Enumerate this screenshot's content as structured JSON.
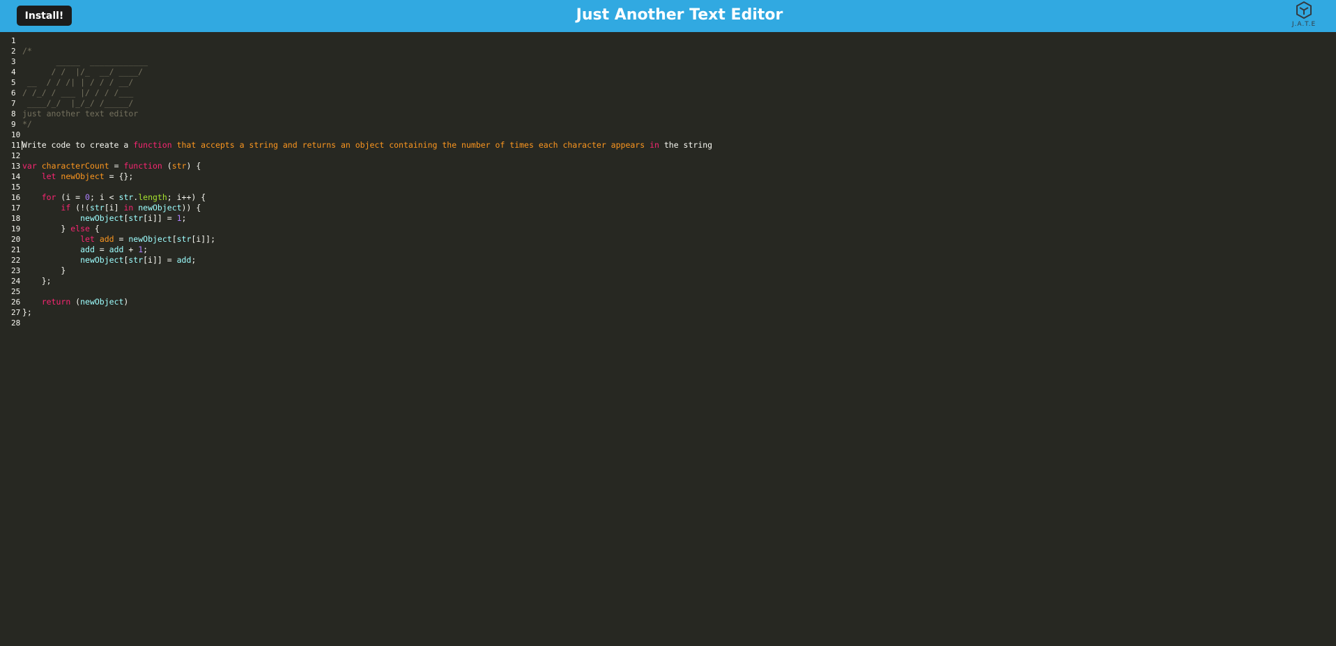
{
  "header": {
    "install_label": "Install!",
    "title": "Just Another Text Editor",
    "logo_text": "J.A.T.E",
    "background": "#31a9e1"
  },
  "editor": {
    "theme_background": "#272822",
    "lines": [
      {
        "n": "1",
        "tokens": []
      },
      {
        "n": "2",
        "tokens": [
          {
            "t": "/*",
            "c": "comment"
          }
        ]
      },
      {
        "n": "3",
        "tokens": [
          {
            "t": "       _____  ____________",
            "c": "comment"
          }
        ]
      },
      {
        "n": "4",
        "tokens": [
          {
            "t": "      / /  |/_  __/ ____/",
            "c": "comment"
          }
        ]
      },
      {
        "n": "5",
        "tokens": [
          {
            "t": " __  / / /| | / / / __/",
            "c": "comment"
          }
        ]
      },
      {
        "n": "6",
        "tokens": [
          {
            "t": "/ /_/ / ___ |/ / / /___",
            "c": "comment"
          }
        ]
      },
      {
        "n": "7",
        "tokens": [
          {
            "t": " ____/_/  |_/_/ /_____/",
            "c": "comment"
          }
        ]
      },
      {
        "n": "8",
        "tokens": [
          {
            "t": "just another text editor",
            "c": "comment"
          }
        ]
      },
      {
        "n": "9",
        "tokens": [
          {
            "t": "*/",
            "c": "comment"
          }
        ]
      },
      {
        "n": "10",
        "tokens": []
      },
      {
        "n": "11",
        "tokens": [
          {
            "t": "Write code to create a ",
            "c": "plain"
          },
          {
            "t": "function",
            "c": "keyword"
          },
          {
            "t": " that accepts a string and returns an object containing the number of times each character appears ",
            "c": "orange"
          },
          {
            "t": "in",
            "c": "keyword"
          },
          {
            "t": " the string",
            "c": "plain"
          }
        ]
      },
      {
        "n": "12",
        "tokens": []
      },
      {
        "n": "13",
        "tokens": [
          {
            "t": "var",
            "c": "keyword"
          },
          {
            "t": " ",
            "c": "plain"
          },
          {
            "t": "characterCount",
            "c": "def"
          },
          {
            "t": " = ",
            "c": "plain"
          },
          {
            "t": "function",
            "c": "keyword"
          },
          {
            "t": " (",
            "c": "plain"
          },
          {
            "t": "str",
            "c": "param"
          },
          {
            "t": ") {",
            "c": "plain"
          }
        ]
      },
      {
        "n": "14",
        "tokens": [
          {
            "t": "    ",
            "c": "plain"
          },
          {
            "t": "let",
            "c": "keyword"
          },
          {
            "t": " ",
            "c": "plain"
          },
          {
            "t": "newObject",
            "c": "def"
          },
          {
            "t": " = {};",
            "c": "plain"
          }
        ]
      },
      {
        "n": "15",
        "tokens": []
      },
      {
        "n": "16",
        "tokens": [
          {
            "t": "    ",
            "c": "plain"
          },
          {
            "t": "for",
            "c": "keyword"
          },
          {
            "t": " (i = ",
            "c": "plain"
          },
          {
            "t": "0",
            "c": "num"
          },
          {
            "t": "; i < ",
            "c": "plain"
          },
          {
            "t": "str",
            "c": "var2"
          },
          {
            "t": ".",
            "c": "plain"
          },
          {
            "t": "length",
            "c": "prop"
          },
          {
            "t": "; i++) {",
            "c": "plain"
          }
        ]
      },
      {
        "n": "17",
        "tokens": [
          {
            "t": "        ",
            "c": "plain"
          },
          {
            "t": "if",
            "c": "keyword"
          },
          {
            "t": " (!(",
            "c": "plain"
          },
          {
            "t": "str",
            "c": "var2"
          },
          {
            "t": "[i] ",
            "c": "plain"
          },
          {
            "t": "in",
            "c": "keyword"
          },
          {
            "t": " ",
            "c": "plain"
          },
          {
            "t": "newObject",
            "c": "var2"
          },
          {
            "t": ")) {",
            "c": "plain"
          }
        ]
      },
      {
        "n": "18",
        "tokens": [
          {
            "t": "            ",
            "c": "plain"
          },
          {
            "t": "newObject",
            "c": "var2"
          },
          {
            "t": "[",
            "c": "plain"
          },
          {
            "t": "str",
            "c": "var2"
          },
          {
            "t": "[i]] = ",
            "c": "plain"
          },
          {
            "t": "1",
            "c": "num"
          },
          {
            "t": ";",
            "c": "plain"
          }
        ]
      },
      {
        "n": "19",
        "tokens": [
          {
            "t": "        } ",
            "c": "plain"
          },
          {
            "t": "else",
            "c": "keyword"
          },
          {
            "t": " {",
            "c": "plain"
          }
        ]
      },
      {
        "n": "20",
        "tokens": [
          {
            "t": "            ",
            "c": "plain"
          },
          {
            "t": "let",
            "c": "keyword"
          },
          {
            "t": " ",
            "c": "plain"
          },
          {
            "t": "add",
            "c": "def"
          },
          {
            "t": " = ",
            "c": "plain"
          },
          {
            "t": "newObject",
            "c": "var2"
          },
          {
            "t": "[",
            "c": "plain"
          },
          {
            "t": "str",
            "c": "var2"
          },
          {
            "t": "[i]];",
            "c": "plain"
          }
        ]
      },
      {
        "n": "21",
        "tokens": [
          {
            "t": "            ",
            "c": "plain"
          },
          {
            "t": "add",
            "c": "var2"
          },
          {
            "t": " = ",
            "c": "plain"
          },
          {
            "t": "add",
            "c": "var2"
          },
          {
            "t": " + ",
            "c": "plain"
          },
          {
            "t": "1",
            "c": "num"
          },
          {
            "t": ";",
            "c": "plain"
          }
        ]
      },
      {
        "n": "22",
        "tokens": [
          {
            "t": "            ",
            "c": "plain"
          },
          {
            "t": "newObject",
            "c": "var2"
          },
          {
            "t": "[",
            "c": "plain"
          },
          {
            "t": "str",
            "c": "var2"
          },
          {
            "t": "[i]] = ",
            "c": "plain"
          },
          {
            "t": "add",
            "c": "var2"
          },
          {
            "t": ";",
            "c": "plain"
          }
        ]
      },
      {
        "n": "23",
        "tokens": [
          {
            "t": "        }",
            "c": "plain"
          }
        ]
      },
      {
        "n": "24",
        "tokens": [
          {
            "t": "    };",
            "c": "plain"
          }
        ]
      },
      {
        "n": "25",
        "tokens": []
      },
      {
        "n": "26",
        "tokens": [
          {
            "t": "    ",
            "c": "plain"
          },
          {
            "t": "return",
            "c": "keyword"
          },
          {
            "t": " (",
            "c": "plain"
          },
          {
            "t": "newObject",
            "c": "var2"
          },
          {
            "t": ")",
            "c": "plain"
          }
        ]
      },
      {
        "n": "27",
        "tokens": [
          {
            "t": "};",
            "c": "plain"
          }
        ]
      },
      {
        "n": "28",
        "tokens": []
      }
    ]
  }
}
